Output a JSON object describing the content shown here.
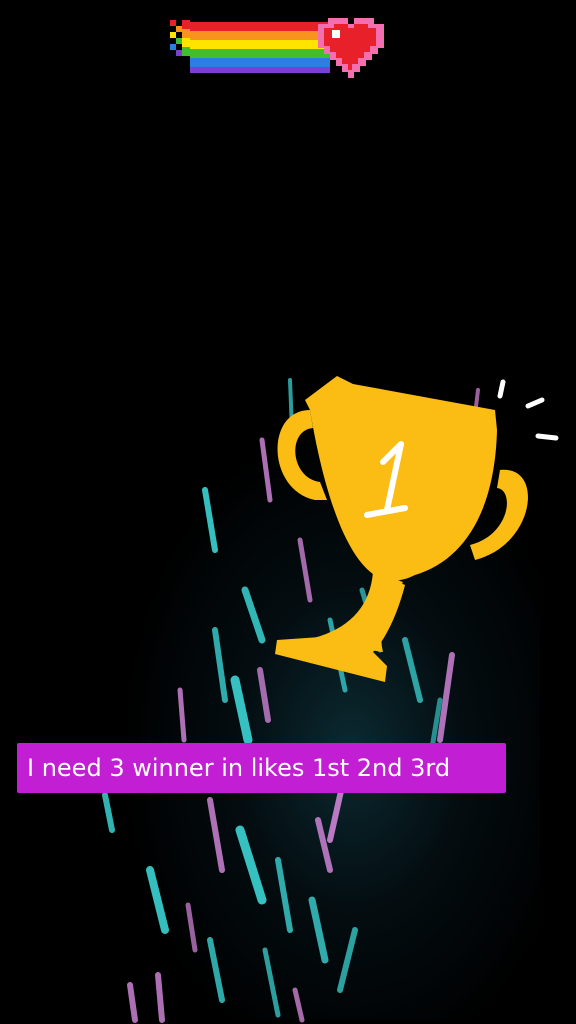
{
  "caption": {
    "text": "I need 3 winner in likes 1st 2nd 3rd"
  },
  "trophy": {
    "rank_label": "1",
    "color": "#fbbd14"
  },
  "colors": {
    "background": "#000000",
    "caption_background": "#c21fd4",
    "caption_text": "#ffffff",
    "heart": "#e8202a",
    "streak_cyan": "#3fe0e0",
    "streak_pink": "#d98be0"
  },
  "icons": {
    "top_sticker": "rainbow-heart-icon",
    "trophy": "trophy-icon",
    "sparkle": "sparkle-icon",
    "fireworks": "fireworks-effect"
  }
}
